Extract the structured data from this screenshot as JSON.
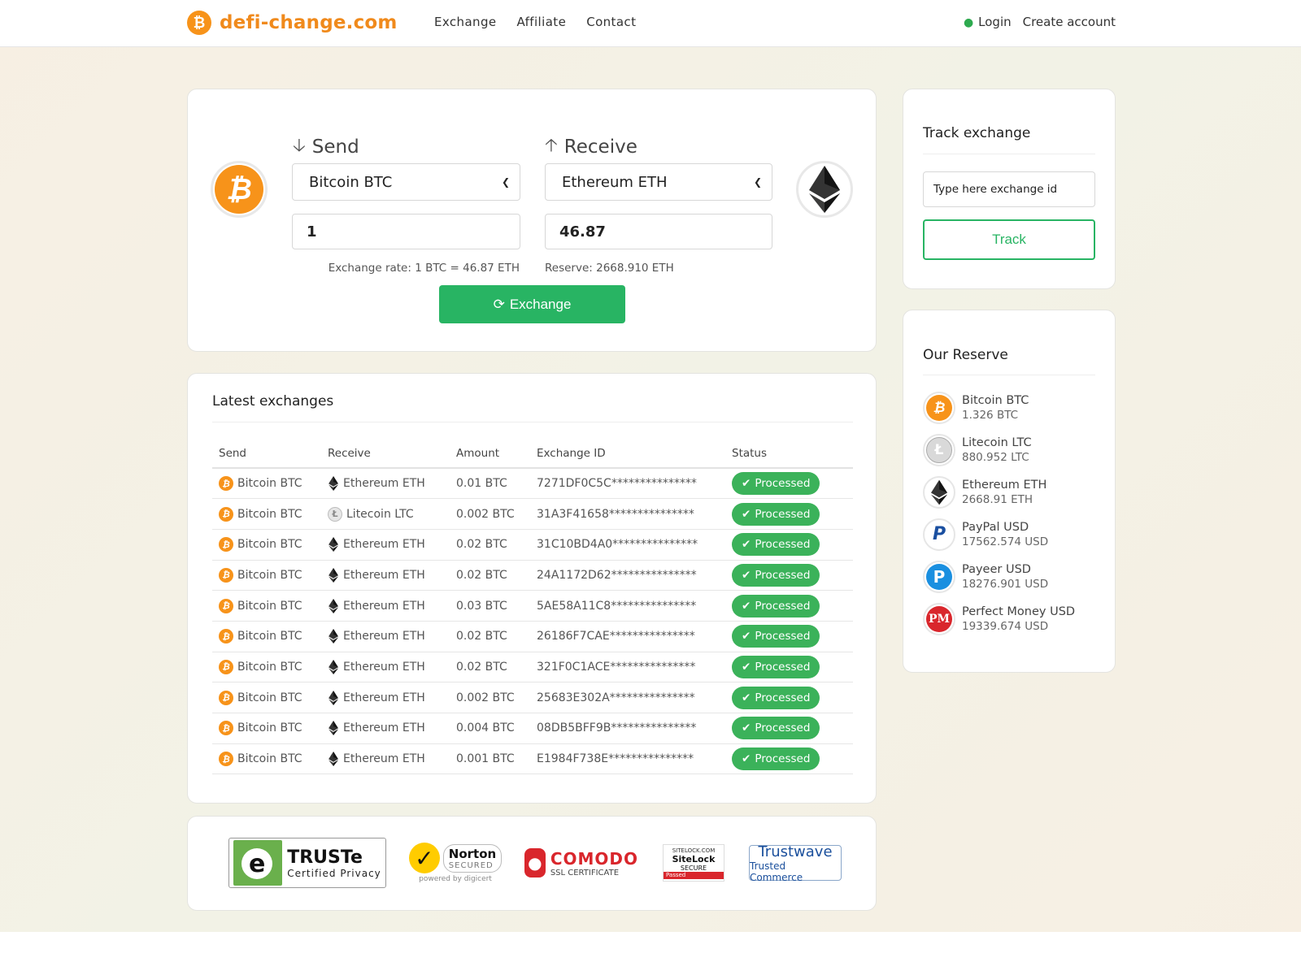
{
  "header": {
    "brand_logo": "₿",
    "brand_name": "defi-change.com",
    "nav": [
      "Exchange",
      "Affiliate",
      "Contact"
    ],
    "login": "Login",
    "create_account": "Create account"
  },
  "exchange": {
    "send_label": "Send",
    "receive_label": "Receive",
    "send_currency": "Bitcoin BTC",
    "receive_currency": "Ethereum ETH",
    "send_amount": "1",
    "receive_amount": "46.87",
    "rate_text": "Exchange rate: 1 BTC = 46.87 ETH",
    "reserve_text": "Reserve: 2668.910 ETH",
    "button_label": "Exchange",
    "accent_color": "#28b463"
  },
  "latest": {
    "title": "Latest exchanges",
    "columns": [
      "Send",
      "Receive",
      "Amount",
      "Exchange ID",
      "Status"
    ],
    "rows": [
      {
        "send": "Bitcoin BTC",
        "receive": "Ethereum ETH",
        "receive_icon": "eth",
        "amount": "0.01 BTC",
        "id": "7271DF0C5C***************",
        "status": "Processed"
      },
      {
        "send": "Bitcoin BTC",
        "receive": "Litecoin LTC",
        "receive_icon": "ltc",
        "amount": "0.002 BTC",
        "id": "31A3F41658***************",
        "status": "Processed"
      },
      {
        "send": "Bitcoin BTC",
        "receive": "Ethereum ETH",
        "receive_icon": "eth",
        "amount": "0.02 BTC",
        "id": "31C10BD4A0***************",
        "status": "Processed"
      },
      {
        "send": "Bitcoin BTC",
        "receive": "Ethereum ETH",
        "receive_icon": "eth",
        "amount": "0.02 BTC",
        "id": "24A1172D62***************",
        "status": "Processed"
      },
      {
        "send": "Bitcoin BTC",
        "receive": "Ethereum ETH",
        "receive_icon": "eth",
        "amount": "0.03 BTC",
        "id": "5AE58A11C8***************",
        "status": "Processed"
      },
      {
        "send": "Bitcoin BTC",
        "receive": "Ethereum ETH",
        "receive_icon": "eth",
        "amount": "0.02 BTC",
        "id": "26186F7CAE***************",
        "status": "Processed"
      },
      {
        "send": "Bitcoin BTC",
        "receive": "Ethereum ETH",
        "receive_icon": "eth",
        "amount": "0.02 BTC",
        "id": "321F0C1ACE***************",
        "status": "Processed"
      },
      {
        "send": "Bitcoin BTC",
        "receive": "Ethereum ETH",
        "receive_icon": "eth",
        "amount": "0.002 BTC",
        "id": "25683E302A***************",
        "status": "Processed"
      },
      {
        "send": "Bitcoin BTC",
        "receive": "Ethereum ETH",
        "receive_icon": "eth",
        "amount": "0.004 BTC",
        "id": "08DB5BFF9B***************",
        "status": "Processed"
      },
      {
        "send": "Bitcoin BTC",
        "receive": "Ethereum ETH",
        "receive_icon": "eth",
        "amount": "0.001 BTC",
        "id": "E1984F738E***************",
        "status": "Processed"
      }
    ],
    "status_color": "#3bb25a"
  },
  "badges": {
    "truste_main": "TRUSTe",
    "truste_sub": "Certified Privacy",
    "norton_main": "Norton",
    "norton_sub": "SECURED",
    "norton_powered": "powered by digicert",
    "comodo_main": "COMODO",
    "comodo_sub": "SSL CERTIFICATE",
    "sitelock_top": "SITELOCK.COM",
    "sitelock_main": "SiteLock",
    "sitelock_sub": "SECURE",
    "sitelock_bar": "Passed",
    "trustwave_main": "Trustwave",
    "trustwave_sub": "Trusted Commerce"
  },
  "track": {
    "title": "Track exchange",
    "placeholder": "Type here exchange id",
    "button_label": "Track"
  },
  "reserve": {
    "title": "Our Reserve",
    "items": [
      {
        "icon": "btc",
        "glyph": "₿",
        "name": "Bitcoin BTC",
        "amount": "1.326 BTC"
      },
      {
        "icon": "ltc",
        "glyph": "Ł",
        "name": "Litecoin LTC",
        "amount": "880.952 LTC"
      },
      {
        "icon": "eth",
        "glyph": "",
        "name": "Ethereum ETH",
        "amount": "2668.91 ETH"
      },
      {
        "icon": "pp",
        "glyph": "P",
        "name": "PayPal USD",
        "amount": "17562.574 USD"
      },
      {
        "icon": "payeer",
        "glyph": "P",
        "name": "Payeer USD",
        "amount": "18276.901 USD"
      },
      {
        "icon": "pm",
        "glyph": "PM",
        "name": "Perfect Money USD",
        "amount": "19339.674 USD"
      }
    ]
  }
}
